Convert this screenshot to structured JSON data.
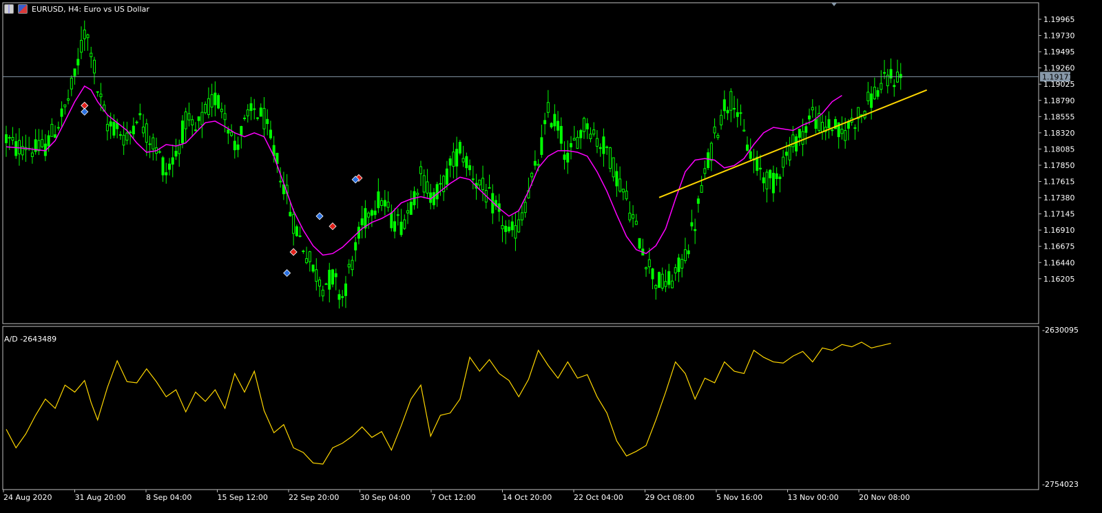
{
  "window": {
    "symbol_title": "EURUSD, H4:  Euro vs US Dollar",
    "icons": [
      "chart-grid-icon",
      "flag-icon"
    ]
  },
  "price_axis": {
    "labels": [
      "1.19965",
      "1.19730",
      "1.19495",
      "1.19260",
      "1.19025",
      "1.18790",
      "1.18555",
      "1.18320",
      "1.18085",
      "1.17850",
      "1.17615",
      "1.17380",
      "1.17145",
      "1.16910",
      "1.16675",
      "1.16440",
      "1.16205"
    ],
    "current_price_label": "1.19171"
  },
  "indicator": {
    "label": "A/D -2643489",
    "axis_top": "-2630095",
    "axis_bottom": "-2754023"
  },
  "time_axis": {
    "labels": [
      "24 Aug 2020",
      "31 Aug 20:00",
      "8 Sep 04:00",
      "15 Sep 12:00",
      "22 Sep 20:00",
      "30 Sep 04:00",
      "7 Oct 12:00",
      "14 Oct 20:00",
      "22 Oct 04:00",
      "29 Oct 08:00",
      "5 Nov 16:00",
      "13 Nov 00:00",
      "20 Nov 08:00"
    ]
  },
  "colors": {
    "background": "#000000",
    "candle": "#00ff00",
    "moving_average": "#ff00ff",
    "ad_line": "#ffd700",
    "trendline": "#ffd700",
    "axis_text": "#ffffff",
    "grid_border": "#c0c0c0",
    "price_line": "#8899aa"
  },
  "chart_data": {
    "type": "line",
    "instrument": "EURUSD",
    "timeframe": "H4",
    "price_range": [
      1.16,
      1.2012
    ],
    "ad_range": [
      -2754023,
      -2630095
    ],
    "price_path": [
      [
        0,
        1.1838
      ],
      [
        3,
        1.1825
      ],
      [
        6,
        1.183
      ],
      [
        9,
        1.1822
      ],
      [
        12,
        1.1828
      ],
      [
        15,
        1.185
      ],
      [
        18,
        1.1875
      ],
      [
        21,
        1.1915
      ],
      [
        24,
        1.1975
      ],
      [
        26,
        1.1955
      ],
      [
        28,
        1.19
      ],
      [
        31,
        1.1855
      ],
      [
        34,
        1.1852
      ],
      [
        37,
        1.1835
      ],
      [
        40,
        1.187
      ],
      [
        43,
        1.1845
      ],
      [
        46,
        1.1825
      ],
      [
        49,
        1.1795
      ],
      [
        52,
        1.1818
      ],
      [
        55,
        1.186
      ],
      [
        58,
        1.1845
      ],
      [
        61,
        1.187
      ],
      [
        64,
        1.189
      ],
      [
        67,
        1.1875
      ],
      [
        70,
        1.1825
      ],
      [
        73,
        1.1855
      ],
      [
        76,
        1.1875
      ],
      [
        79,
        1.1862
      ],
      [
        82,
        1.182
      ],
      [
        85,
        1.178
      ],
      [
        88,
        1.173
      ],
      [
        91,
        1.17
      ],
      [
        94,
        1.167
      ],
      [
        97,
        1.165
      ],
      [
        100,
        1.166
      ],
      [
        103,
        1.1635
      ],
      [
        106,
        1.168
      ],
      [
        109,
        1.1725
      ],
      [
        112,
        1.1752
      ],
      [
        115,
        1.176
      ],
      [
        118,
        1.1735
      ],
      [
        121,
        1.1728
      ],
      [
        124,
        1.1755
      ],
      [
        127,
        1.179
      ],
      [
        130,
        1.1765
      ],
      [
        133,
        1.177
      ],
      [
        136,
        1.18
      ],
      [
        139,
        1.1825
      ],
      [
        142,
        1.18
      ],
      [
        145,
        1.1778
      ],
      [
        148,
        1.176
      ],
      [
        151,
        1.174
      ],
      [
        154,
        1.1712
      ],
      [
        157,
        1.1725
      ],
      [
        160,
        1.177
      ],
      [
        163,
        1.1808
      ],
      [
        166,
        1.187
      ],
      [
        169,
        1.1855
      ],
      [
        172,
        1.181
      ],
      [
        175,
        1.184
      ],
      [
        178,
        1.186
      ],
      [
        181,
        1.1835
      ],
      [
        184,
        1.1825
      ],
      [
        187,
        1.179
      ],
      [
        190,
        1.176
      ],
      [
        193,
        1.172
      ],
      [
        196,
        1.1685
      ],
      [
        199,
        1.1655
      ],
      [
        202,
        1.165
      ],
      [
        205,
        1.166
      ],
      [
        208,
        1.169
      ],
      [
        211,
        1.173
      ],
      [
        214,
        1.179
      ],
      [
        217,
        1.184
      ],
      [
        220,
        1.188
      ],
      [
        223,
        1.189
      ],
      [
        226,
        1.184
      ],
      [
        229,
        1.1808
      ],
      [
        232,
        1.179
      ],
      [
        235,
        1.178
      ],
      [
        238,
        1.181
      ],
      [
        241,
        1.183
      ],
      [
        244,
        1.1845
      ],
      [
        247,
        1.187
      ],
      [
        250,
        1.185
      ],
      [
        253,
        1.1855
      ],
      [
        256,
        1.184
      ],
      [
        259,
        1.186
      ],
      [
        262,
        1.187
      ],
      [
        265,
        1.189
      ],
      [
        268,
        1.1905
      ],
      [
        271,
        1.1915
      ],
      [
        274,
        1.1917
      ]
    ],
    "moving_average": [
      [
        0,
        1.1827
      ],
      [
        6,
        1.1825
      ],
      [
        12,
        1.1822
      ],
      [
        15,
        1.1835
      ],
      [
        18,
        1.186
      ],
      [
        21,
        1.1885
      ],
      [
        24,
        1.1905
      ],
      [
        26,
        1.19
      ],
      [
        28,
        1.1885
      ],
      [
        31,
        1.1868
      ],
      [
        34,
        1.1858
      ],
      [
        37,
        1.1848
      ],
      [
        40,
        1.1832
      ],
      [
        43,
        1.182
      ],
      [
        46,
        1.1822
      ],
      [
        49,
        1.183
      ],
      [
        52,
        1.1828
      ],
      [
        55,
        1.1832
      ],
      [
        58,
        1.1845
      ],
      [
        61,
        1.1858
      ],
      [
        64,
        1.186
      ],
      [
        67,
        1.1853
      ],
      [
        70,
        1.1845
      ],
      [
        73,
        1.184
      ],
      [
        76,
        1.1845
      ],
      [
        79,
        1.184
      ],
      [
        82,
        1.1815
      ],
      [
        85,
        1.178
      ],
      [
        88,
        1.1745
      ],
      [
        91,
        1.172
      ],
      [
        94,
        1.17
      ],
      [
        97,
        1.1688
      ],
      [
        100,
        1.169
      ],
      [
        103,
        1.1698
      ],
      [
        106,
        1.171
      ],
      [
        109,
        1.1722
      ],
      [
        112,
        1.173
      ],
      [
        115,
        1.1735
      ],
      [
        118,
        1.1742
      ],
      [
        121,
        1.1755
      ],
      [
        124,
        1.176
      ],
      [
        127,
        1.1763
      ],
      [
        130,
        1.176
      ],
      [
        133,
        1.177
      ],
      [
        136,
        1.178
      ],
      [
        139,
        1.1788
      ],
      [
        142,
        1.1785
      ],
      [
        145,
        1.1772
      ],
      [
        148,
        1.176
      ],
      [
        151,
        1.1748
      ],
      [
        154,
        1.1738
      ],
      [
        157,
        1.1745
      ],
      [
        160,
        1.177
      ],
      [
        163,
        1.18
      ],
      [
        166,
        1.1815
      ],
      [
        169,
        1.1822
      ],
      [
        172,
        1.1822
      ],
      [
        175,
        1.182
      ],
      [
        178,
        1.1815
      ],
      [
        181,
        1.1795
      ],
      [
        184,
        1.177
      ],
      [
        187,
        1.174
      ],
      [
        190,
        1.1712
      ],
      [
        193,
        1.1695
      ],
      [
        196,
        1.169
      ],
      [
        199,
        1.17
      ],
      [
        202,
        1.1722
      ],
      [
        205,
        1.176
      ],
      [
        208,
        1.1795
      ],
      [
        211,
        1.181
      ],
      [
        214,
        1.1812
      ],
      [
        217,
        1.181
      ],
      [
        220,
        1.18
      ],
      [
        223,
        1.1803
      ],
      [
        226,
        1.1812
      ],
      [
        229,
        1.183
      ],
      [
        232,
        1.1845
      ],
      [
        235,
        1.1852
      ],
      [
        238,
        1.185
      ],
      [
        241,
        1.1848
      ],
      [
        244,
        1.1855
      ],
      [
        247,
        1.186
      ],
      [
        250,
        1.187
      ],
      [
        253,
        1.1885
      ],
      [
        256,
        1.1893
      ]
    ],
    "ad_path": [
      [
        0,
        -2708000
      ],
      [
        3,
        -2724000
      ],
      [
        6,
        -2712000
      ],
      [
        9,
        -2696000
      ],
      [
        12,
        -2682000
      ],
      [
        15,
        -2690000
      ],
      [
        18,
        -2670000
      ],
      [
        21,
        -2676000
      ],
      [
        24,
        -2666000
      ],
      [
        26,
        -2685000
      ],
      [
        28,
        -2700000
      ],
      [
        31,
        -2672000
      ],
      [
        34,
        -2649000
      ],
      [
        37,
        -2667000
      ],
      [
        40,
        -2668000
      ],
      [
        43,
        -2656000
      ],
      [
        46,
        -2667000
      ],
      [
        49,
        -2680000
      ],
      [
        52,
        -2674000
      ],
      [
        55,
        -2693000
      ],
      [
        58,
        -2676000
      ],
      [
        61,
        -2684000
      ],
      [
        64,
        -2674000
      ],
      [
        67,
        -2690000
      ],
      [
        70,
        -2660000
      ],
      [
        73,
        -2676000
      ],
      [
        76,
        -2658000
      ],
      [
        79,
        -2692000
      ],
      [
        82,
        -2711000
      ],
      [
        85,
        -2704000
      ],
      [
        88,
        -2724000
      ],
      [
        91,
        -2728000
      ],
      [
        94,
        -2737000
      ],
      [
        97,
        -2738000
      ],
      [
        100,
        -2724000
      ],
      [
        103,
        -2720000
      ],
      [
        106,
        -2714000
      ],
      [
        109,
        -2706000
      ],
      [
        112,
        -2715000
      ],
      [
        115,
        -2710000
      ],
      [
        118,
        -2726000
      ],
      [
        121,
        -2705000
      ],
      [
        124,
        -2682000
      ],
      [
        127,
        -2670000
      ],
      [
        130,
        -2714000
      ],
      [
        133,
        -2696000
      ],
      [
        136,
        -2694000
      ],
      [
        139,
        -2682000
      ],
      [
        142,
        -2646000
      ],
      [
        145,
        -2658000
      ],
      [
        148,
        -2648000
      ],
      [
        151,
        -2660000
      ],
      [
        154,
        -2666000
      ],
      [
        157,
        -2680000
      ],
      [
        160,
        -2665000
      ],
      [
        163,
        -2640000
      ],
      [
        166,
        -2653000
      ],
      [
        169,
        -2664000
      ],
      [
        172,
        -2650000
      ],
      [
        175,
        -2664000
      ],
      [
        178,
        -2661000
      ],
      [
        181,
        -2680000
      ],
      [
        184,
        -2694000
      ],
      [
        187,
        -2718000
      ],
      [
        190,
        -2731000
      ],
      [
        193,
        -2727000
      ],
      [
        196,
        -2722000
      ],
      [
        199,
        -2700000
      ],
      [
        202,
        -2676000
      ],
      [
        205,
        -2650000
      ],
      [
        208,
        -2660000
      ],
      [
        211,
        -2682000
      ],
      [
        214,
        -2664000
      ],
      [
        217,
        -2668000
      ],
      [
        220,
        -2650000
      ],
      [
        223,
        -2658000
      ],
      [
        226,
        -2660000
      ],
      [
        229,
        -2640000
      ],
      [
        232,
        -2646000
      ],
      [
        235,
        -2650000
      ],
      [
        238,
        -2651000
      ],
      [
        241,
        -2645000
      ],
      [
        244,
        -2641000
      ],
      [
        247,
        -2650000
      ],
      [
        250,
        -2638000
      ],
      [
        253,
        -2640000
      ],
      [
        256,
        -2635000
      ],
      [
        259,
        -2637000
      ],
      [
        262,
        -2633000
      ],
      [
        265,
        -2638000
      ],
      [
        268,
        -2636000
      ],
      [
        271,
        -2634000
      ]
    ],
    "trendline": [
      [
        200,
        1.1762
      ],
      [
        282,
        1.19
      ]
    ],
    "current_price": 1.19171,
    "arrows": [
      {
        "i": 24,
        "price": 1.188,
        "dir": "sell"
      },
      {
        "i": 24,
        "price": 1.1872,
        "dir": "buy"
      },
      {
        "i": 88,
        "price": 1.1692,
        "dir": "sell"
      },
      {
        "i": 86,
        "price": 1.1665,
        "dir": "buy"
      },
      {
        "i": 100,
        "price": 1.1725,
        "dir": "sell"
      },
      {
        "i": 96,
        "price": 1.1738,
        "dir": "buy"
      },
      {
        "i": 108,
        "price": 1.1787,
        "dir": "sell"
      },
      {
        "i": 107,
        "price": 1.1785,
        "dir": "buy"
      }
    ]
  }
}
